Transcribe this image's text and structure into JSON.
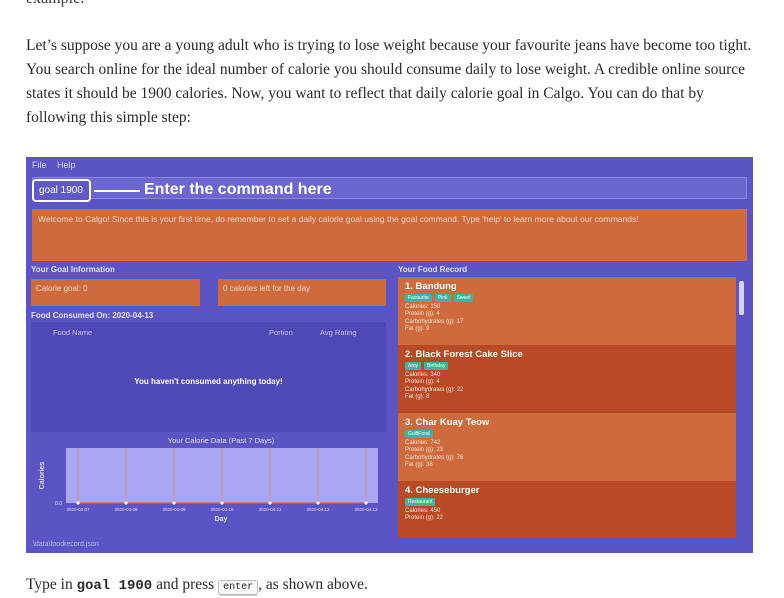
{
  "doc": {
    "prev_line": "example.",
    "paragraph": "Let’s suppose you are a young adult who is trying to lose weight because your favourite jeans have become too tight. You search online for the ideal number of calorie you should consume daily to lose weight. A credible online source states it should be 1900 calories. Now, you want to reflect that daily calorie goal in Calgo. You can do that by following this simple step:",
    "bottom_prefix": "Type in ",
    "bottom_code": "goal 1900",
    "bottom_mid": " and press ",
    "bottom_key": "enter",
    "bottom_suffix": ", as shown above."
  },
  "app": {
    "menu": [
      "File",
      "Help"
    ],
    "command_text": "goal 1900",
    "annotation": "Enter the command here",
    "result_text": "Welcome to Calgo! Since this is your first time, do remember to set a daily calorie goal using the goal command. Type 'help' to learn more about our commands!",
    "goal_header": "Your Goal Information",
    "goal_value": "Calorie goal: 0",
    "calories_left": "0 calories left for the day",
    "consumed_header": "Food Consumed On: 2020-04-13",
    "table_headers": {
      "name": "Food Name",
      "portion": "Portion",
      "rating": "Avg Rating"
    },
    "empty_message": "You haven't consumed anything today!",
    "food_record_header": "Your Food Record",
    "status": ".\\data\\foodrecord.json",
    "foods": [
      {
        "name": "1.  Bandung",
        "tags": [
          "Favourite",
          "Pink",
          "Sweet"
        ],
        "lines": [
          "Calories: 150",
          "Protein (g): 4",
          "Carbohydrates (g): 17",
          "Fat (g): 9"
        ]
      },
      {
        "name": "2.  Black Forest Cake Slice",
        "tags": [
          "Amy",
          "Birthday"
        ],
        "lines": [
          "Calories: 340",
          "Protein (g): 4",
          "Carbohydrates (g): 22",
          "Fat (g): 8"
        ]
      },
      {
        "name": "3.  Char Kuay Teow",
        "tags": [
          "GuiltFood"
        ],
        "lines": [
          "Calories: 742",
          "Protein (g): 23",
          "Carbohydrates (g): 76",
          "Fat (g): 38"
        ]
      },
      {
        "name": "4.  Cheeseburger",
        "tags": [
          "Restaurant"
        ],
        "lines": [
          "Calories: 450",
          "Protein (g): 22"
        ]
      }
    ]
  },
  "chart_data": {
    "type": "line",
    "title": "Your Calorie Data (Past 7 Days)",
    "xlabel": "Day",
    "ylabel": "Calories",
    "x": [
      "2020-04-07",
      "2020-04-08",
      "2020-04-09",
      "2020-04-10",
      "2020-04-11",
      "2020-04-12",
      "2020-04-13"
    ],
    "series": [
      {
        "values": [
          0,
          0,
          0,
          0,
          0,
          0,
          0
        ]
      }
    ],
    "ytick": "0.0",
    "ylim": [
      0,
      1
    ],
    "grid": true,
    "colors": {
      "plot_bg": "#a9a6f2",
      "line": "#f05a3a",
      "grid": "#e07a5a",
      "text": "#e2e0ff"
    }
  }
}
